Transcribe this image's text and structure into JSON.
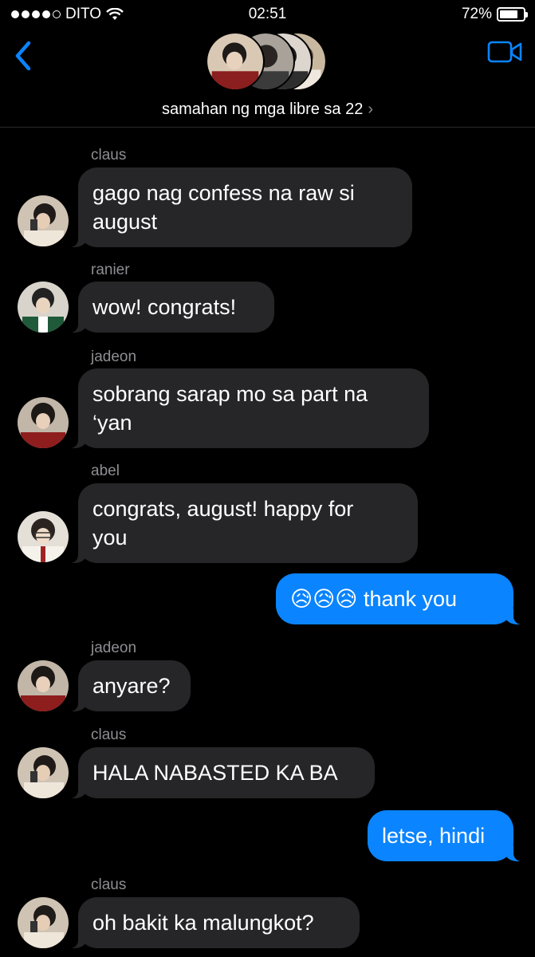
{
  "status_bar": {
    "carrier": "DITO",
    "time": "02:51",
    "battery": "72%"
  },
  "header": {
    "title": "samahan ng mga libre sa 22",
    "chevron": "›"
  },
  "messages": [
    {
      "sender": "claus",
      "text_lines": [
        "gago nag confess na raw si",
        "august"
      ]
    },
    {
      "sender": "ranier",
      "text_lines": [
        "wow! congrats!"
      ]
    },
    {
      "sender": "jadeon",
      "text_lines": [
        "sobrang sarap mo sa part na",
        "‘yan"
      ]
    },
    {
      "sender": "abel",
      "text_lines": [
        "congrats, august! happy for",
        "you"
      ]
    },
    {
      "text": "😥😥😥 thank you"
    },
    {
      "sender": "jadeon",
      "text_lines": [
        "anyare?"
      ]
    },
    {
      "sender": "claus",
      "text_lines": [
        "HALA NABASTED KA BA"
      ]
    },
    {
      "text": "letse, hindi"
    },
    {
      "sender": "claus",
      "text_lines": [
        "oh bakit ka malungkot?"
      ]
    }
  ],
  "icons": {
    "back": "chevron-left-icon",
    "video": "video-camera-icon",
    "wifi": "wifi-icon",
    "battery": "battery-icon",
    "signal": "signal-dots-icon"
  },
  "colors": {
    "accent": "#0a84ff",
    "incoming_bubble": "#262628",
    "secondary_text": "#8e8e93",
    "background": "#000000"
  }
}
